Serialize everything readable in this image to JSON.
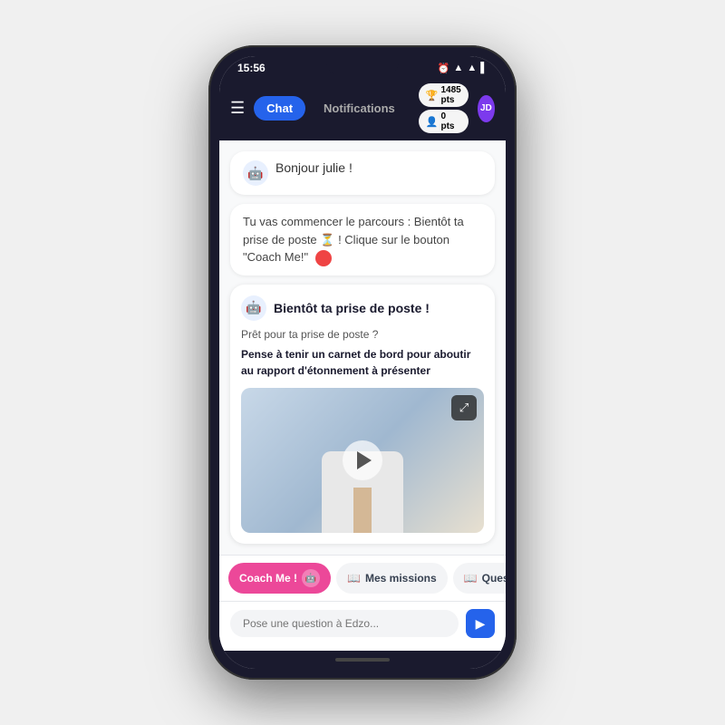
{
  "status": {
    "time": "15:56",
    "icons": [
      "⏰",
      "▲",
      "▲",
      "▌"
    ]
  },
  "nav": {
    "chat_label": "Chat",
    "notifications_label": "Notifications",
    "points_label": "1485 pts",
    "challenge_label": "0 pts",
    "avatar_initials": "JD"
  },
  "messages": [
    {
      "type": "greeting",
      "text": "Bonjour julie !"
    },
    {
      "type": "text",
      "text": "Tu vas commencer le parcours : Bientôt ta prise de poste ⏳ ! Clique sur le bouton \"Coach Me!\""
    }
  ],
  "card": {
    "title": "Bientôt ta prise de poste !",
    "subtitle": "Prêt pour ta prise de poste ?",
    "body_bold": "Pense à tenir un carnet de bord pour aboutir au rapport d'étonnement à présenter"
  },
  "bottom_nav": {
    "coach_me_label": "Coach Me !",
    "missions_label": "Mes missions",
    "quests_label": "Ques"
  },
  "input": {
    "placeholder": "Pose une question à Edzo..."
  }
}
